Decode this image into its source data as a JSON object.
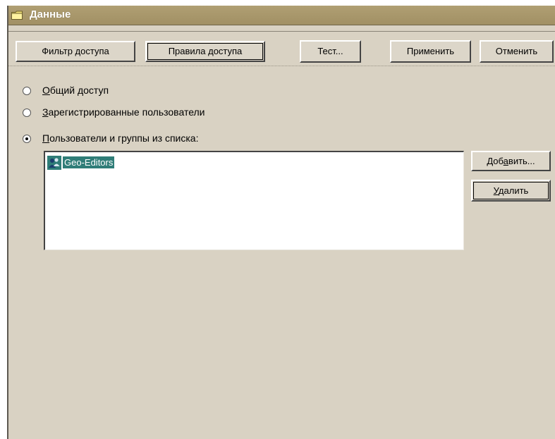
{
  "window": {
    "title": "Данные"
  },
  "toolbar": {
    "filter_tab": "Фильтр доступа",
    "rules_tab": "Правила доступа",
    "test_button": "Тест...",
    "apply_button": "Применить",
    "cancel_button": "Отменить"
  },
  "access": {
    "options": [
      {
        "mnemonic": "О",
        "rest": "бщий доступ",
        "checked": false
      },
      {
        "mnemonic": "З",
        "rest": "арегистрированные пользователи",
        "checked": false
      },
      {
        "mnemonic": "П",
        "rest": "ользователи и группы из списка:",
        "checked": true
      }
    ],
    "list_items": [
      {
        "label": "Geo-Editors",
        "icon": "user-group-icon",
        "selected": true
      }
    ],
    "add_button": {
      "before": "Доб",
      "mnemonic": "а",
      "after": "вить..."
    },
    "remove_button": {
      "mnemonic": "У",
      "after": "далить"
    }
  },
  "colors": {
    "dialog_bg": "#d9d2c3",
    "titlebar": "#a89769",
    "selection": "#2f7d78"
  }
}
